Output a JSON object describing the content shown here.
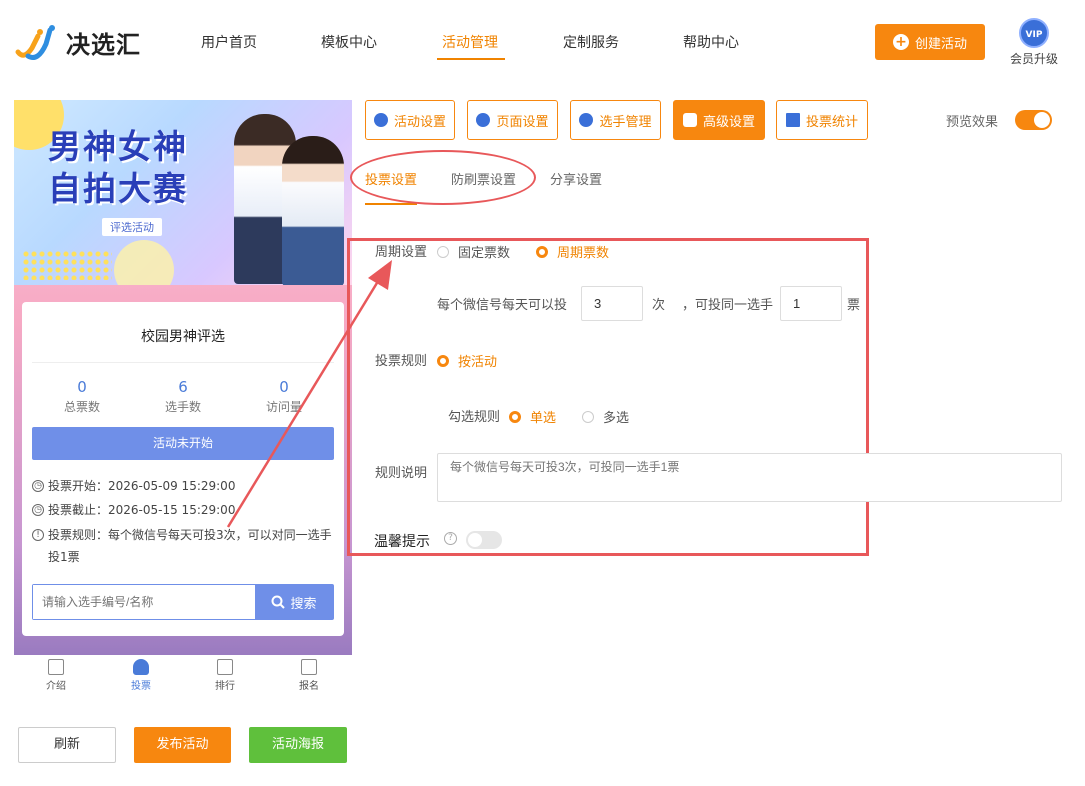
{
  "brand": {
    "name": "决选汇"
  },
  "nav": {
    "items": [
      {
        "label": "用户首页",
        "active": false
      },
      {
        "label": "模板中心",
        "active": false
      },
      {
        "label": "活动管理",
        "active": true
      },
      {
        "label": "定制服务",
        "active": false
      },
      {
        "label": "帮助中心",
        "active": false
      }
    ]
  },
  "header": {
    "create_label": "创建活动",
    "vip_badge": "VIP",
    "vip_label": "会员升级"
  },
  "preview": {
    "banner_title_line1": "男神女神",
    "banner_title_line2": "自拍大赛",
    "banner_sub": "评选活动",
    "card_title": "校园男神评选",
    "stats": [
      {
        "value": "0",
        "label": "总票数"
      },
      {
        "value": "6",
        "label": "选手数"
      },
      {
        "value": "0",
        "label": "访问量"
      }
    ],
    "status_label": "活动未开始",
    "vote_start": "投票开始：2026-05-09 15:29:00",
    "vote_end": "投票截止：2026-05-15 15:29:00",
    "vote_rule": "投票规则：每个微信号每天可投3次，可以对同一选手投1票",
    "search_placeholder": "请输入选手编号/名称",
    "search_label": "搜索",
    "tabs": [
      {
        "label": "介绍",
        "active": false
      },
      {
        "label": "投票",
        "active": true
      },
      {
        "label": "排行",
        "active": false
      },
      {
        "label": "报名",
        "active": false
      }
    ]
  },
  "actions": {
    "refresh": "刷新",
    "publish": "发布活动",
    "poster": "活动海报"
  },
  "settings_tabs": [
    {
      "label": "活动设置",
      "active": false
    },
    {
      "label": "页面设置",
      "active": false
    },
    {
      "label": "选手管理",
      "active": false
    },
    {
      "label": "高级设置",
      "active": true
    },
    {
      "label": "投票统计",
      "active": false
    }
  ],
  "preview_toggle": {
    "label": "预览效果",
    "on": true
  },
  "sub_tabs": [
    {
      "label": "投票设置",
      "active": true
    },
    {
      "label": "防刷票设置",
      "active": false
    },
    {
      "label": "分享设置",
      "active": false
    }
  ],
  "form": {
    "cycle_label": "周期设置",
    "cycle_options": [
      {
        "label": "固定票数",
        "checked": false
      },
      {
        "label": "周期票数",
        "checked": true
      }
    ],
    "per_day_prefix": "每个微信号每天可以投",
    "per_day_value": "3",
    "per_day_unit": "次",
    "same_player_prefix": "，可投同一选手",
    "same_player_value": "1",
    "same_player_unit": "票",
    "vote_rule_label": "投票规则",
    "vote_rule_option": "按活动",
    "check_rule_label": "勾选规则",
    "check_options": [
      {
        "label": "单选",
        "checked": true
      },
      {
        "label": "多选",
        "checked": false
      }
    ],
    "rule_desc_label": "规则说明",
    "rule_desc_placeholder": "每个微信号每天可投3次，可投同一选手1票",
    "tip_label": "温馨提示",
    "tip_on": false
  },
  "colors": {
    "accent": "#f7870f",
    "blue": "#6f8fe8",
    "green": "#5fc03c",
    "annotation": "#e8585a"
  }
}
